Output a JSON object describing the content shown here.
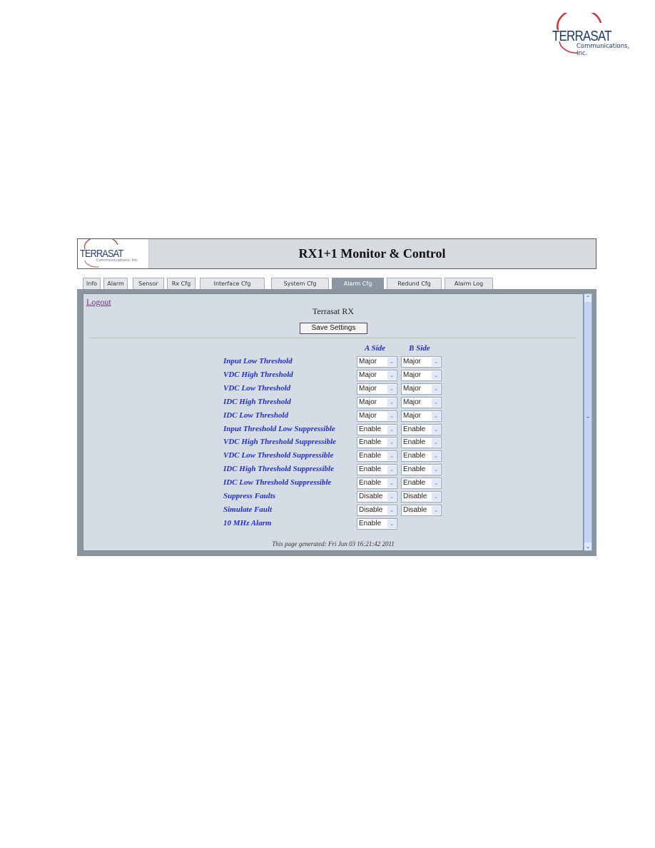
{
  "corporate_logo": {
    "brand": "TERRASAT",
    "subtitle": "Communications, Inc."
  },
  "banner": {
    "logo_brand": "TERRASAT",
    "logo_subtitle": "Communications, Inc",
    "title": "RX1+1 Monitor & Control"
  },
  "tabs": [
    {
      "label": "Info",
      "active": false
    },
    {
      "label": "Alarm",
      "active": false
    },
    {
      "label": "Sensor",
      "active": false
    },
    {
      "label": "Rx Cfg",
      "active": false
    },
    {
      "label": "Interface Cfg",
      "active": false
    },
    {
      "label": "System Cfg",
      "active": false
    },
    {
      "label": "Alarm Cfg",
      "active": true
    },
    {
      "label": "Redund Cfg",
      "active": false
    },
    {
      "label": "Alarm Log",
      "active": false
    }
  ],
  "content": {
    "logout_label": "Logout",
    "heading": "Terrasat RX",
    "save_label": "Save Settings",
    "col_a": "A Side",
    "col_b": "B Side",
    "rows": [
      {
        "label": "Input Low Threshold",
        "a": "Major",
        "b": "Major"
      },
      {
        "label": "VDC High Threshold",
        "a": "Major",
        "b": "Major"
      },
      {
        "label": "VDC Low Threshold",
        "a": "Major",
        "b": "Major"
      },
      {
        "label": "IDC High Threshold",
        "a": "Major",
        "b": "Major"
      },
      {
        "label": "IDC Low Threshold",
        "a": "Major",
        "b": "Major"
      },
      {
        "label": "Input Threshold Low Suppressible",
        "a": "Enable",
        "b": "Enable"
      },
      {
        "label": "VDC High Threshold Suppressible",
        "a": "Enable",
        "b": "Enable"
      },
      {
        "label": "VDC Low Threshold Suppressible",
        "a": "Enable",
        "b": "Enable"
      },
      {
        "label": "IDC High Threshold Suppressible",
        "a": "Enable",
        "b": "Enable"
      },
      {
        "label": "IDC Low Threshold Suppressible",
        "a": "Enable",
        "b": "Enable"
      },
      {
        "label": "Suppress Faults",
        "a": "Disable",
        "b": "Disable"
      },
      {
        "label": "Simulate Fault",
        "a": "Disable",
        "b": "Disable"
      },
      {
        "label": "10 MHz Alarm",
        "a": "Enable",
        "b": null
      }
    ],
    "footer": "This page generated: Fri Jun 03 16:21:42 2011"
  },
  "icons": {
    "dropdown": "chevron-down-icon",
    "scroll_up": "chevron-up-icon",
    "scroll_down": "chevron-down-icon"
  },
  "colors": {
    "label_blue": "#1f2fd0",
    "active_tab": "#8b97a3",
    "frame": "#8a949e",
    "content_bg": "#d6dce3",
    "logo_red": "#c8323a",
    "logo_navy": "#1f3a6b"
  }
}
